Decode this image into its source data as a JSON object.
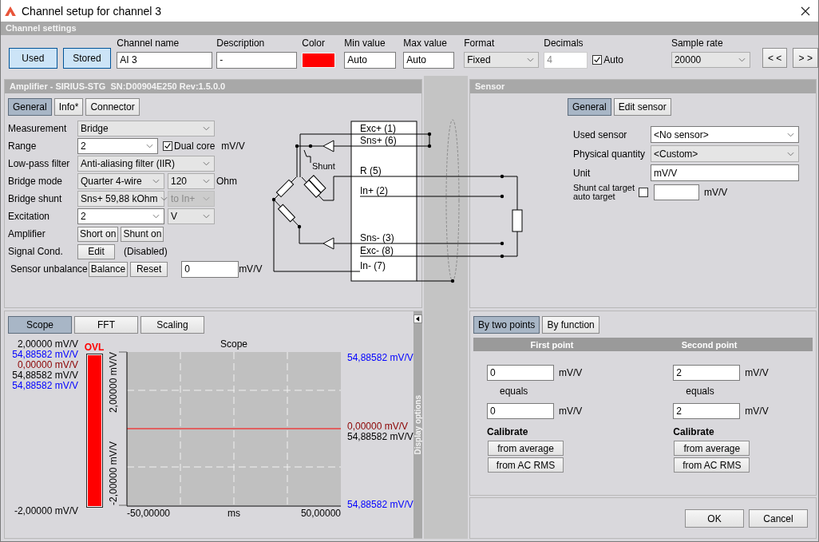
{
  "window": {
    "title": "Channel setup for channel 3"
  },
  "channel_settings": {
    "title": "Channel settings",
    "toggles": [
      {
        "label": "Used",
        "on": true
      },
      {
        "label": "Stored",
        "on": true
      }
    ],
    "fields": [
      {
        "kind": "text",
        "label": "Channel name",
        "value": "AI 3"
      },
      {
        "kind": "text",
        "label": "Description",
        "value": "-"
      },
      {
        "kind": "color",
        "label": "Color",
        "color": "#ff0000"
      },
      {
        "kind": "text",
        "label": "Min value",
        "value": "Auto"
      },
      {
        "kind": "text",
        "label": "Max value",
        "value": "Auto"
      },
      {
        "kind": "select",
        "label": "Format",
        "value": "Fixed"
      },
      {
        "kind": "number",
        "label": "Decimals",
        "value": "4",
        "disabled": true,
        "auto": {
          "label": "Auto",
          "checked": true
        }
      },
      {
        "kind": "select",
        "label": "Sample rate",
        "value": "20000"
      }
    ],
    "nav_buttons": [
      "< <",
      "> >"
    ]
  },
  "amplifier": {
    "title": "Amplifier - SIRIUS-STG  SN:D00904E250 Rev:1.5.0.0",
    "tabs": [
      {
        "label": "General",
        "selected": true
      },
      {
        "label": "Info*",
        "selected": false
      },
      {
        "label": "Connector",
        "selected": false
      }
    ],
    "measurement": {
      "label": "Measurement",
      "value": "Bridge"
    },
    "range": {
      "label": "Range",
      "value": "2",
      "dual_core": {
        "label": "Dual core",
        "checked": true
      },
      "unit": "mV/V"
    },
    "low_pass_filter": {
      "label": "Low-pass filter",
      "value": "Anti-aliasing filter (IIR)"
    },
    "bridge_mode": {
      "label": "Bridge mode",
      "value": "Quarter 4-wire",
      "resistance": "120",
      "unit": "Ohm"
    },
    "bridge_shunt": {
      "label": "Bridge shunt",
      "value": "Sns+ 59,88 kOhm",
      "target": {
        "value": "to In+",
        "disabled": true
      }
    },
    "excitation": {
      "label": "Excitation",
      "value": "2",
      "unit": "V"
    },
    "amplifier_row": {
      "label": "Amplifier",
      "buttons": [
        "Short on",
        "Shunt on"
      ]
    },
    "signal_cond": {
      "label": "Signal Cond.",
      "button": "Edit",
      "status": "(Disabled)"
    },
    "sensor_unbalance": {
      "label": "Sensor unbalance",
      "buttons": [
        "Balance",
        "Reset"
      ],
      "value": "0",
      "unit": "mV/V"
    }
  },
  "diagram": {
    "terminals": [
      "Exc+ (1)",
      "Sns+ (6)",
      "R (5)",
      "In+ (2)",
      "Sns- (3)",
      "Exc- (8)",
      "In- (7)"
    ],
    "shunt_label": "Shunt"
  },
  "sensor": {
    "title": "Sensor",
    "tabs": [
      {
        "label": "General",
        "selected": true
      },
      {
        "label": "Edit sensor",
        "selected": false
      }
    ],
    "used_sensor": {
      "label": "Used sensor",
      "value": "<No sensor>"
    },
    "physical_quantity": {
      "label": "Physical quantity",
      "value": "<Custom>"
    },
    "unit": {
      "label": "Unit",
      "value": "mV/V"
    },
    "shunt_target": {
      "label": "Shunt cal target auto target",
      "checked": false,
      "unit": "mV/V"
    }
  },
  "scope": {
    "tabs": [
      {
        "label": "Scope",
        "selected": true
      },
      {
        "label": "FFT",
        "selected": false
      },
      {
        "label": "Scaling",
        "selected": false
      }
    ],
    "left_readings": [
      {
        "text": "2,00000 mV/V",
        "color": "#000000"
      },
      {
        "text": "54,88582 mV/V",
        "color": "#0000ff"
      },
      {
        "text": "0,00000 mV/V",
        "color": "#8b0000"
      },
      {
        "text": "54,88582 mV/V",
        "color": "#000000"
      },
      {
        "text": "54,88582 mV/V",
        "color": "#0000ff"
      }
    ],
    "bottom_reading": "-2,00000 mV/V",
    "meter": {
      "label": "OVL",
      "level": 1
    },
    "plot": {
      "title": "Scope",
      "xlabel": "ms",
      "x_labels": [
        "-50,00000",
        "50,00000"
      ],
      "y_labels": [
        "2,00000 mV/V",
        "-2,00000 mV/V"
      ]
    },
    "right_readings": [
      {
        "text": "54,88582 mV/V",
        "color": "#0000ff"
      },
      {
        "text": "0,00000 mV/V",
        "color": "#8b0000"
      },
      {
        "text": "54,88582 mV/V",
        "color": "#000000"
      },
      {
        "text": "54,88582 mV/V",
        "color": "#0000ff"
      }
    ],
    "side_tab": "Display options"
  },
  "scaling": {
    "tabs": [
      {
        "label": "By two points",
        "selected": true
      },
      {
        "label": "By function",
        "selected": false
      }
    ],
    "points": [
      {
        "title": "First point",
        "input": "0",
        "input_unit": "mV/V",
        "equals": "equals",
        "output": "0",
        "output_unit": "mV/V",
        "calibrate": "Calibrate",
        "buttons": [
          "from average",
          "from AC RMS"
        ]
      },
      {
        "title": "Second point",
        "input": "2",
        "input_unit": "mV/V",
        "equals": "equals",
        "output": "2",
        "output_unit": "mV/V",
        "calibrate": "Calibrate",
        "buttons": [
          "from average",
          "from AC RMS"
        ]
      }
    ]
  },
  "buttons": [
    "OK",
    "Cancel"
  ]
}
